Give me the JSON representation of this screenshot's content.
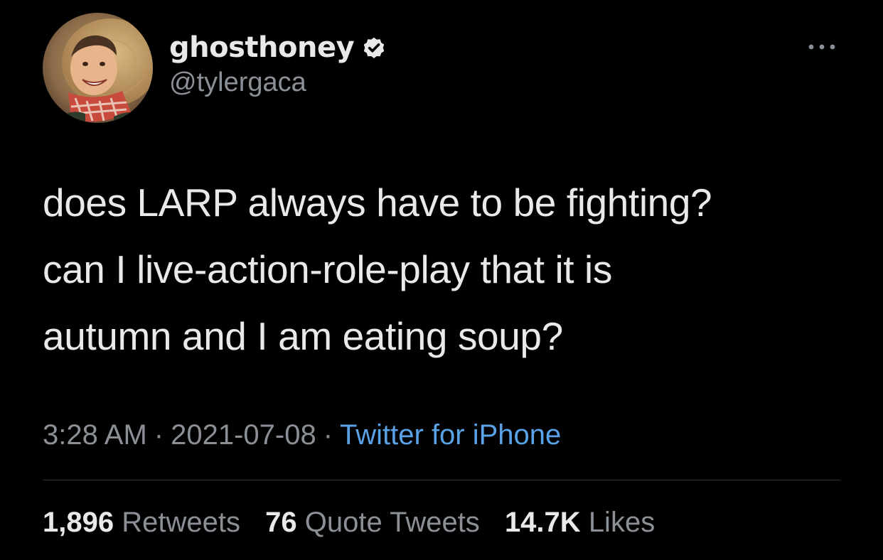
{
  "tweet": {
    "author": {
      "display_name": "ghosthoney",
      "handle": "@tylergaca",
      "verified": true,
      "avatar_icon": "profile-photo-child-in-straw-hat"
    },
    "more_icon": "more-options-icon",
    "text_lines": [
      "does LARP always have to be fighting?",
      "can I live-action-role-play that it is",
      "autumn and I am eating soup?"
    ],
    "time": "3:28 AM",
    "date": "2021-07-08",
    "separator": "·",
    "source": "Twitter for iPhone",
    "stats": {
      "retweets_count": "1,896",
      "retweets_label": "Retweets",
      "quotes_count": "76",
      "quotes_label": "Quote Tweets",
      "likes_count": "14.7K",
      "likes_label": "Likes"
    }
  },
  "colors": {
    "background": "#000000",
    "primary_text": "#e7e9ea",
    "secondary_text": "#8b9096",
    "link": "#5aa2e6",
    "divider": "#2f3336"
  }
}
